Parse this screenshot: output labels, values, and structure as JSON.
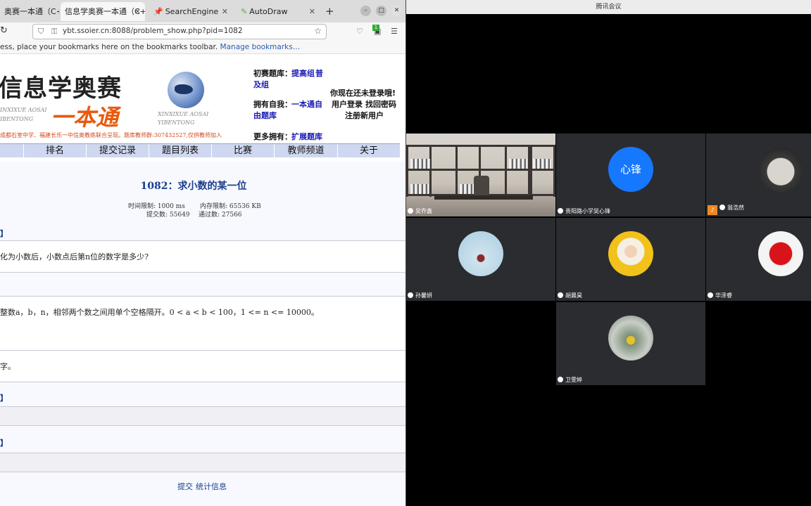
{
  "browser": {
    "tabs": [
      {
        "label": "奥赛一本通（C++"
      },
      {
        "label": "信息学奥赛一本通（C++"
      },
      {
        "label": "SearchEngine"
      },
      {
        "label": "AutoDraw"
      }
    ],
    "new_tab": "+",
    "url": "ybt.ssoier.cn:8088/problem_show.php?pid=1082",
    "bookmarks_text": "ess, place your bookmarks here on the bookmarks toolbar.",
    "bookmarks_link": "Manage bookmarks…",
    "ext_badge": "1"
  },
  "site": {
    "banner_title": "信息学奥赛",
    "banner_big": "一本通",
    "banner_sub1": "INXIXUE AOSAI",
    "banner_sub2": "IBENTONG",
    "banner_sub3": "XINXIXUE  AOSAI",
    "banner_sub4": "YIBENTONG",
    "banner_foot": "成都石室中学、福建长乐一中信奥教练联合呈现。题库教师群:307432527,仅供教师加入",
    "side": {
      "l1_label": "初赛题库：",
      "l1_link1": "提高组",
      "l1_link2": "普",
      "l1_link3": "及组",
      "l2_label": "拥有自我：",
      "l2_link1": "一本通自",
      "l2_link2": "由题库",
      "l3_label": "更多拥有：",
      "l3_link": "扩展题库",
      "login_msg": "你现在还未登录哦!",
      "login": "用户登录",
      "recover": "找回密码",
      "register": "注册新用户"
    },
    "menu": [
      "排名",
      "提交记录",
      "题目列表",
      "比赛",
      "教师频道",
      "关于"
    ]
  },
  "problem": {
    "title": "1082：求小数的某一位",
    "time_limit": "时间限制: 1000 ms",
    "memory_limit": "内存限制: 65536 KB",
    "submissions": "提交数: 55649",
    "accepted": "通过数: 27566",
    "sec1_head": "】",
    "sec1_text": "化为小数后，小数点后第n位的数字是多少?",
    "sec2_text": "整数a，b，n，相邻两个数之间用单个空格隔开。0 < a < b < 100，1 <= n <= 10000。",
    "sec3_text": "字。",
    "sec4_head": "】",
    "sec5_head": "】",
    "bottom_submit": "提交",
    "bottom_stats": "统计信息"
  },
  "meeting": {
    "title": "腾讯会议",
    "participants": [
      {
        "name": "吴乔鑫"
      },
      {
        "name": "贵阳路小学吴心锋",
        "avatar_text": "心锋"
      },
      {
        "name": "翁浩然"
      },
      {
        "name": "孙馨妍"
      },
      {
        "name": "胡晨昊"
      },
      {
        "name": "华泽睿"
      },
      {
        "name": "卫雯婷"
      }
    ],
    "colors": {
      "tile": "#2b2c30",
      "avatar_blue": "#1677ff"
    }
  }
}
